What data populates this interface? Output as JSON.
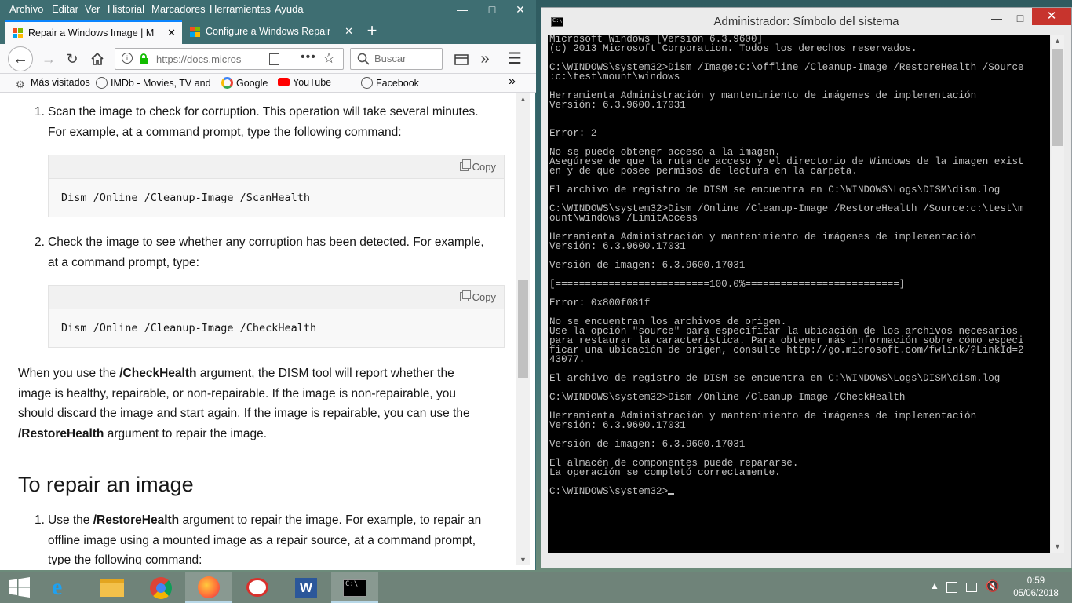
{
  "firefox": {
    "menu": [
      "Archivo",
      "Editar",
      "Ver",
      "Historial",
      "Marcadores",
      "Herramientas",
      "Ayuda"
    ],
    "tabs": [
      {
        "title": "Repair a Windows Image | Microsoft Docs",
        "active": true
      },
      {
        "title": "Configure a Windows Repair Source",
        "active": false
      }
    ],
    "url": "https://docs.microsoft.com",
    "search_placeholder": "Buscar",
    "bookmarks": [
      "Más visitados",
      "IMDb - Movies, TV and Celebrities",
      "Google",
      "YouTube",
      "Facebook"
    ],
    "content": {
      "step1": "Scan the image to check for corruption. This operation will take several minutes.",
      "step1b": "For example, at a command prompt, type the following command:",
      "code1": "Dism /Online /Cleanup-Image /ScanHealth",
      "step2": "Check the image to see whether any corruption has been detected. For example,",
      "step2b": "at a command prompt, type:",
      "code2": "Dism /Online /Cleanup-Image /CheckHealth",
      "copy_label": "Copy",
      "p_intro": "When you use the ",
      "p_bold1": "/CheckHealth",
      "p_l1": " argument, the DISM tool will report whether the",
      "p_l2": "image is healthy, repairable, or non-repairable. If the image is non-repairable, you",
      "p_l3": "should discard the image and start again. If the image is repairable, you can use the",
      "p_bold2": "/RestoreHealth",
      "p_l4": " argument to repair the image.",
      "heading": "To repair an image",
      "s3_a": "Use the ",
      "s3_bold": "/RestoreHealth",
      "s3_b": " argument to repair the image. For example, to repair an",
      "s3_l2": "offline image using a mounted image as a repair source, at a command prompt,",
      "s3_l3": "type the following command:"
    }
  },
  "cmd": {
    "title": "Administrador: Símbolo del sistema",
    "lines": [
      "Microsoft Windows [Versión 6.3.9600]",
      "(c) 2013 Microsoft Corporation. Todos los derechos reservados.",
      "",
      "C:\\WINDOWS\\system32>Dism /Image:C:\\offline /Cleanup-Image /RestoreHealth /Source",
      ":c:\\test\\mount\\windows",
      "",
      "Herramienta Administración y mantenimiento de imágenes de implementación",
      "Versión: 6.3.9600.17031",
      "",
      "",
      "Error: 2",
      "",
      "No se puede obtener acceso a la imagen.",
      "Asegúrese de que la ruta de acceso y el directorio de Windows de la imagen exist",
      "en y de que posee permisos de lectura en la carpeta.",
      "",
      "El archivo de registro de DISM se encuentra en C:\\WINDOWS\\Logs\\DISM\\dism.log",
      "",
      "C:\\WINDOWS\\system32>Dism /Online /Cleanup-Image /RestoreHealth /Source:c:\\test\\m",
      "ount\\windows /LimitAccess",
      "",
      "Herramienta Administración y mantenimiento de imágenes de implementación",
      "Versión: 6.3.9600.17031",
      "",
      "Versión de imagen: 6.3.9600.17031",
      "",
      "[==========================100.0%==========================]",
      "",
      "Error: 0x800f081f",
      "",
      "No se encuentran los archivos de origen.",
      "Use la opción \"source\" para especificar la ubicación de los archivos necesarios",
      "para restaurar la característica. Para obtener más información sobre cómo especi",
      "ficar una ubicación de origen, consulte http://go.microsoft.com/fwlink/?LinkId=2",
      "43077.",
      "",
      "El archivo de registro de DISM se encuentra en C:\\WINDOWS\\Logs\\DISM\\dism.log",
      "",
      "C:\\WINDOWS\\system32>Dism /Online /Cleanup-Image /CheckHealth",
      "",
      "Herramienta Administración y mantenimiento de imágenes de implementación",
      "Versión: 6.3.9600.17031",
      "",
      "Versión de imagen: 6.3.9600.17031",
      "",
      "El almacén de componentes puede repararse.",
      "La operación se completó correctamente.",
      "",
      "C:\\WINDOWS\\system32>"
    ]
  },
  "taskbar": {
    "apps": [
      "start",
      "internet-explorer",
      "file-explorer",
      "chrome",
      "firefox",
      "snipping-tool",
      "word",
      "command-prompt"
    ],
    "time": "0:59",
    "date": "05/06/2018"
  }
}
